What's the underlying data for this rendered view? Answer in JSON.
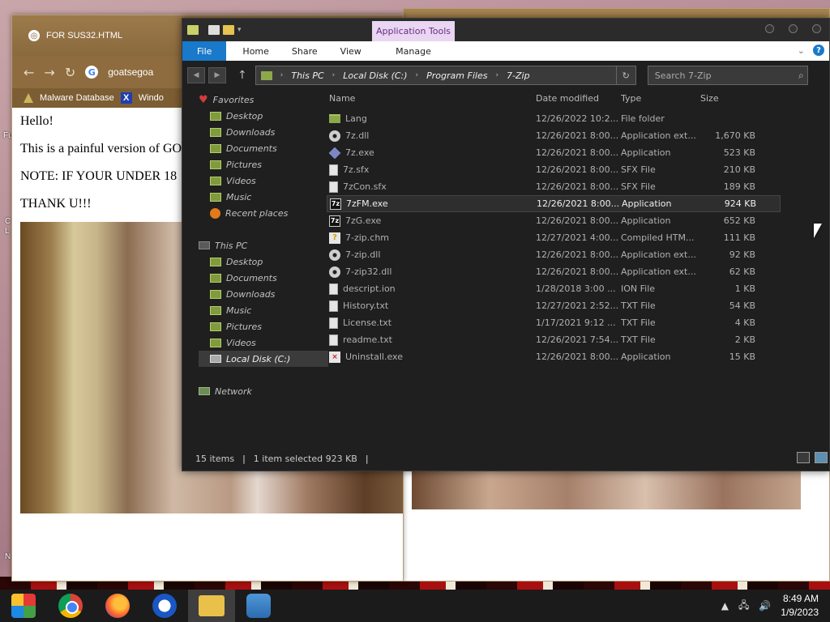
{
  "desktop": {
    "left_labels": [
      "Fu",
      "C",
      "L",
      "N"
    ]
  },
  "browser": {
    "tab_title": "FOR SUS32.HTML",
    "url": "goatsegoa",
    "bookmarks": [
      "Malware Database",
      "Windo"
    ],
    "content": [
      "Hello!",
      "This is a painful version of GO",
      "NOTE: IF YOUR UNDER 18",
      "THANK U!!!"
    ]
  },
  "explorer": {
    "quick_access_menu": "▾",
    "context_tab": "Application Tools",
    "ribbon_tabs": {
      "file": "File",
      "home": "Home",
      "share": "Share",
      "view": "View",
      "manage": "Manage"
    },
    "address": {
      "crumbs": [
        "This PC",
        "Local Disk (C:)",
        "Program Files",
        "7-Zip"
      ],
      "search_placeholder": "Search 7-Zip"
    },
    "nav": {
      "favorites": "Favorites",
      "fav_items": [
        "Desktop",
        "Downloads",
        "Documents",
        "Pictures",
        "Videos",
        "Music",
        "Recent places"
      ],
      "this_pc": "This PC",
      "pc_items": [
        "Desktop",
        "Documents",
        "Downloads",
        "Music",
        "Pictures",
        "Videos",
        "Local Disk (C:)"
      ],
      "network": "Network"
    },
    "columns": {
      "name": "Name",
      "date": "Date modified",
      "type": "Type",
      "size": "Size"
    },
    "files": [
      {
        "name": "Lang",
        "date": "12/26/2022 10:2...",
        "type": "File folder",
        "size": "",
        "icon": "folder-icon"
      },
      {
        "name": "7z.dll",
        "date": "12/26/2021 8:00...",
        "type": "Application ext...",
        "size": "1,670 KB",
        "icon": "gear-icon"
      },
      {
        "name": "7z.exe",
        "date": "12/26/2021 8:00...",
        "type": "Application",
        "size": "523 KB",
        "icon": "app-icon"
      },
      {
        "name": "7z.sfx",
        "date": "12/26/2021 8:00...",
        "type": "SFX File",
        "size": "210 KB",
        "icon": "document-icon"
      },
      {
        "name": "7zCon.sfx",
        "date": "12/26/2021 8:00...",
        "type": "SFX File",
        "size": "189 KB",
        "icon": "document-icon"
      },
      {
        "name": "7zFM.exe",
        "date": "12/26/2021 8:00...",
        "type": "Application",
        "size": "924 KB",
        "icon": "7zip-icon"
      },
      {
        "name": "7zG.exe",
        "date": "12/26/2021 8:00...",
        "type": "Application",
        "size": "652 KB",
        "icon": "7zip-icon"
      },
      {
        "name": "7-zip.chm",
        "date": "12/27/2021 4:00...",
        "type": "Compiled HTM...",
        "size": "111 KB",
        "icon": "help-icon"
      },
      {
        "name": "7-zip.dll",
        "date": "12/26/2021 8:00...",
        "type": "Application ext...",
        "size": "92 KB",
        "icon": "gear-icon"
      },
      {
        "name": "7-zip32.dll",
        "date": "12/26/2021 8:00...",
        "type": "Application ext...",
        "size": "62 KB",
        "icon": "gear-icon"
      },
      {
        "name": "descript.ion",
        "date": "1/28/2018 3:00 ...",
        "type": "ION File",
        "size": "1 KB",
        "icon": "document-icon"
      },
      {
        "name": "History.txt",
        "date": "12/27/2021 2:52...",
        "type": "TXT File",
        "size": "54 KB",
        "icon": "document-icon"
      },
      {
        "name": "License.txt",
        "date": "1/17/2021 9:12 ...",
        "type": "TXT File",
        "size": "4 KB",
        "icon": "document-icon"
      },
      {
        "name": "readme.txt",
        "date": "12/26/2021 7:54...",
        "type": "TXT File",
        "size": "2 KB",
        "icon": "document-icon"
      },
      {
        "name": "Uninstall.exe",
        "date": "12/26/2021 8:00...",
        "type": "Application",
        "size": "15 KB",
        "icon": "uninstall-icon"
      }
    ],
    "selected_file": "7zFM.exe",
    "status": {
      "count": "15 items",
      "selection": "1 item selected  923 KB"
    }
  },
  "taskbar": {
    "time": "8:49 AM",
    "date": "1/9/2023"
  }
}
